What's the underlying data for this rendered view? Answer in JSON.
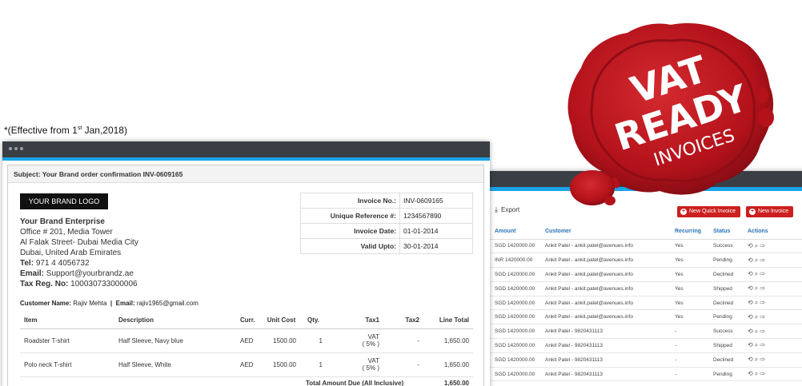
{
  "effective_note": {
    "prefix": "*(Effective from 1",
    "sup": "st",
    "suffix": " Jan,2018)"
  },
  "seal": {
    "line1": "VAT",
    "line2": "READY",
    "line3": "INVOICES",
    "color": "#b3121b"
  },
  "invoice": {
    "subject": "Subject: Your Brand order confirmation INV-0609165",
    "logo_text": "YOUR BRAND LOGO",
    "company": {
      "name": "Your Brand Enterprise",
      "address1": "Office # 201, Media Tower",
      "address2": "Al Falak Street- Dubai Media City",
      "address3": "Dubai, United Arab Emirates",
      "tel_label": "Tel:",
      "tel": " 971 4 4056732",
      "email_label": "Email:",
      "email": " Support@yourbrandz.ae",
      "tax_label": "Tax Reg. No:",
      "tax": " 100030733000006"
    },
    "meta": [
      {
        "label": "Invoice No.:",
        "value": "INV-0609165"
      },
      {
        "label": "Unique Reference #:",
        "value": "1234567890"
      },
      {
        "label": "Invoice Date:",
        "value": "01-01-2014"
      },
      {
        "label": "Valid Upto:",
        "value": "30-01-2014"
      }
    ],
    "customer": {
      "name_label": "Customer Name:",
      "name": " Rajiv Mehta",
      "sep": "  |  ",
      "email_label": "Email:",
      "email": " rajiv1965@gmail.com"
    },
    "headers": [
      "Item",
      "Description",
      "Curr.",
      "Unit Cost",
      "Qty.",
      "Tax1",
      "Tax2",
      "Line Total"
    ],
    "rows": [
      {
        "item": "Roadster T-shirt",
        "desc": "Half Sleeve, Navy blue",
        "curr": "AED",
        "unit": "1500.00",
        "qty": "1",
        "tax1a": "VAT",
        "tax1b": "( 5% )",
        "tax2": "-",
        "total": "1,650.00"
      },
      {
        "item": "Polo neck T-shirt",
        "desc": "Half Sleeve, White",
        "curr": "AED",
        "unit": "1500.00",
        "qty": "1",
        "tax1a": "VAT",
        "tax1b": "( 5% )",
        "tax2": "-",
        "total": "1,650.00"
      }
    ],
    "total_label": "Total Amount Due (All Inclusive)",
    "total_value": "1,650.00"
  },
  "list": {
    "export_label": "Export",
    "quick_btn": "New Quick Invoice",
    "new_btn": "New Invoice",
    "headers": [
      "Amount",
      "Customer",
      "Recurring",
      "Status",
      "Actions"
    ],
    "rows": [
      {
        "amount": "SGD  1420000.00",
        "customer": "Ankit Patel - ankit.patel@avenues.info",
        "recurring": "Yes",
        "status": "Success"
      },
      {
        "amount": "INR  1420000.00",
        "customer": "Ankit Patel - ankit.patel@avenues.info",
        "recurring": "Yes",
        "status": "Pending"
      },
      {
        "amount": "SGD  1420000.00",
        "customer": "Ankit Patel - ankit.patel@avenues.info",
        "recurring": "Yes",
        "status": "Declined"
      },
      {
        "amount": "SGD  1420000.00",
        "customer": "Ankit Patel - ankit.patel@avenues.info",
        "recurring": "Yes",
        "status": "Shipped"
      },
      {
        "amount": "SGD  1420000.00",
        "customer": "Ankit Patel - ankit.patel@avenues.info",
        "recurring": "Yes",
        "status": "Declined"
      },
      {
        "amount": "SGD  1420000.00",
        "customer": "Ankit Patel - ankit.patel@avenues.info",
        "recurring": "Yes",
        "status": "Pending"
      },
      {
        "amount": "SGD  1420000.00",
        "customer": "Ankit Patel - 9820431113",
        "recurring": "-",
        "status": "Success"
      },
      {
        "amount": "SGD  1420000.00",
        "customer": "Ankit Patel - 9820431113",
        "recurring": "-",
        "status": "Shipped"
      },
      {
        "amount": "SGD  1420000.00",
        "customer": "Ankit Patel - 9820431113",
        "recurring": "-",
        "status": "Declined"
      },
      {
        "amount": "SGD  1420000.00",
        "customer": "Ankit Patel - 9820431113",
        "recurring": "-",
        "status": "Pending"
      }
    ],
    "action_icons": [
      "history-icon",
      "search-doc-icon",
      "forward-icon"
    ]
  },
  "colors": {
    "accent": "#1aa3e8",
    "red_button": "#cc1f1f",
    "titlebar": "#3a3f45",
    "link_blue": "#2a73b8"
  }
}
